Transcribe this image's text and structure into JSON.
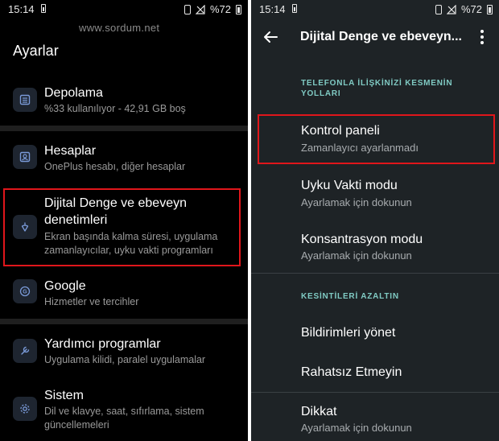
{
  "watermark": "www.sordum.net",
  "left": {
    "status": {
      "time": "15:14",
      "battery": "%72"
    },
    "title": "Ayarlar",
    "items": [
      {
        "title": "Depolama",
        "subtitle": "%33 kullanılıyor - 42,91 GB boş",
        "icon": "storage-icon"
      },
      {
        "title": "Hesaplar",
        "subtitle": "OnePlus hesabı, diğer hesaplar",
        "icon": "account-icon"
      },
      {
        "title_line1": "Dijital Denge ve ebeveyn",
        "title_line2": "denetimleri",
        "subtitle_line1": "Ekran başında kalma süresi, uygulama",
        "subtitle_line2": "zamanlayıcılar, uyku vakti programları",
        "icon": "wellbeing-icon"
      },
      {
        "title": "Google",
        "subtitle": "Hizmetler ve tercihler",
        "icon": "google-icon"
      },
      {
        "title": "Yardımcı programlar",
        "subtitle": "Uygulama kilidi, paralel uygulamalar",
        "icon": "utilities-icon"
      },
      {
        "title": "Sistem",
        "subtitle_line1": "Dil ve klavye, saat, sıfırlama, sistem",
        "subtitle_line2": "güncellemeleri",
        "icon": "gear-icon"
      }
    ]
  },
  "right": {
    "status": {
      "time": "15:14",
      "battery": "%72"
    },
    "title": "Dijital Denge ve ebeveyn...",
    "section1": {
      "line1": "TELEFONLA İLİŞKİNİZİ KESMENİN",
      "line2": "YOLLARI"
    },
    "items1": [
      {
        "title": "Kontrol paneli",
        "subtitle": "Zamanlayıcı ayarlanmadı"
      },
      {
        "title": "Uyku Vakti modu",
        "subtitle": "Ayarlamak için dokunun"
      },
      {
        "title": "Konsantrasyon modu",
        "subtitle": "Ayarlamak için dokunun"
      }
    ],
    "section2": "KESİNTİLERİ AZALTIN",
    "items2": [
      {
        "title": "Bildirimleri yönet"
      },
      {
        "title": "Rahatsız Etmeyin"
      },
      {
        "title": "Dikkat",
        "subtitle": "Ayarlamak için dokunun"
      }
    ]
  }
}
